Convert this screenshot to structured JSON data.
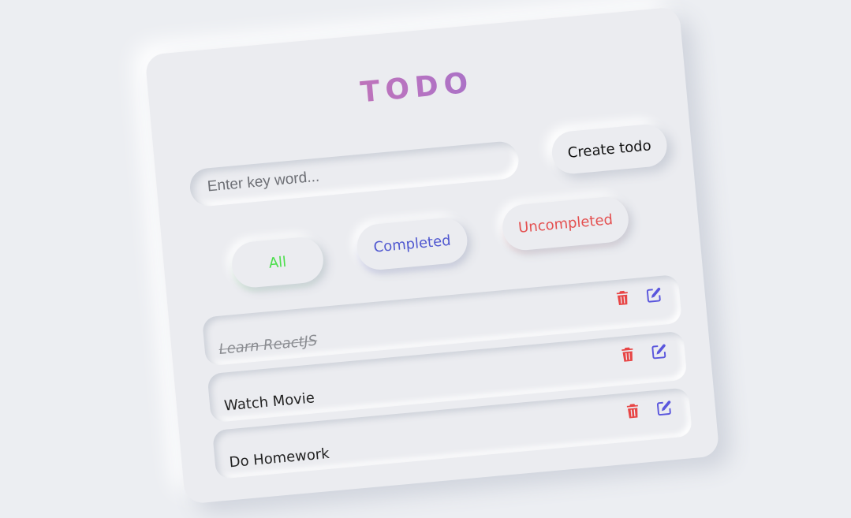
{
  "app": {
    "title": "TODO"
  },
  "search": {
    "placeholder": "Enter key word...",
    "value": ""
  },
  "create_button": {
    "label": "Create todo"
  },
  "filters": {
    "all": "All",
    "completed": "Completed",
    "uncompleted": "Uncompleted"
  },
  "todos": [
    {
      "text": "Learn ReactJS",
      "completed": true
    },
    {
      "text": "Watch Movie",
      "completed": false
    },
    {
      "text": "Do Homework",
      "completed": false
    }
  ],
  "icons": {
    "delete": "trash-icon",
    "edit": "edit-icon"
  },
  "colors": {
    "background": "#eceef2",
    "all_filter": "#4cde4c",
    "completed_filter": "#5058d0",
    "uncompleted_filter": "#e45050",
    "delete_icon": "#e84545",
    "edit_icon": "#5a56dd",
    "title_gradient_start": "#d9739c",
    "title_gradient_end": "#7b6bd6"
  }
}
